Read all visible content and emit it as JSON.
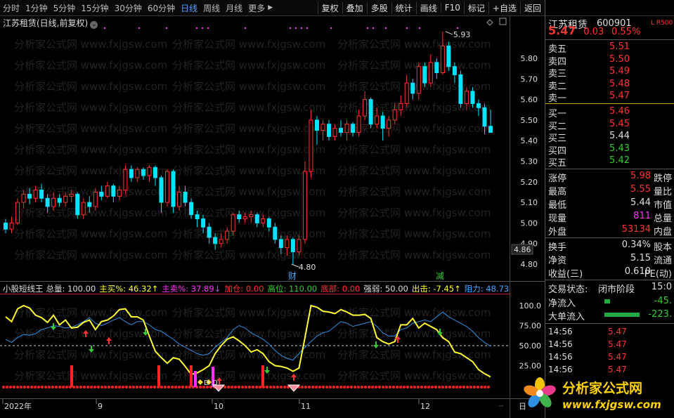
{
  "toolbar": {
    "periods": [
      "分时",
      "1分钟",
      "5分钟",
      "15分钟",
      "30分钟",
      "60分钟",
      "日线",
      "周线",
      "月线",
      "更多"
    ],
    "active_period": "日线",
    "more_arrow": "▶",
    "tools": [
      "复权",
      "叠加",
      "多股",
      "统计",
      "画线",
      "F10",
      "标记",
      "+自选",
      "返回"
    ]
  },
  "chart": {
    "title": "江苏租赁(日线,前复权)",
    "y_labels": [
      "5.80",
      "5.70",
      "5.60",
      "5.50",
      "5.40",
      "5.30",
      "5.20",
      "5.10",
      "5.00",
      "4.90",
      "4.80"
    ],
    "current_price_label": "4.86",
    "high_mark": "5.93",
    "low_mark": "4.80",
    "event_cai": "财",
    "event_jian": "减",
    "watermark": "分析家公式网 www.fxjgsw.com"
  },
  "indicator": {
    "name": "小股短线王",
    "items": [
      {
        "label": "总量: 100.00",
        "color": "#dddddd"
      },
      {
        "label": "主买%: 46.32↑",
        "color": "#ffff33"
      },
      {
        "label": "主卖%: 37.89↓",
        "color": "#ff33ff"
      },
      {
        "label": "加仓: 0.00",
        "color": "#ff3333"
      },
      {
        "label": "高位: 110.00",
        "color": "#33cc33"
      },
      {
        "label": "底部: 0.00",
        "color": "#ff3333"
      },
      {
        "label": "强弱: 50.00",
        "color": "#dddddd"
      },
      {
        "label": "出击: -7.45↑",
        "color": "#ffff33"
      },
      {
        "label": "阻力: 48.73",
        "color": "#4aa3ff"
      }
    ],
    "y_labels": [
      "100.0",
      "75.00",
      "50.00",
      "25.00"
    ],
    "marker_d": "D"
  },
  "x_axis": {
    "labels": [
      "2022年",
      "9",
      "10",
      "11",
      "12"
    ],
    "right_label": "日"
  },
  "quote": {
    "name": "江苏租赁",
    "code": "600901",
    "lr": "L R500",
    "price": "5.47",
    "change": "0.03",
    "pct": "0.55%"
  },
  "orderbook": {
    "asks": [
      {
        "label": "卖五",
        "price": "5.51"
      },
      {
        "label": "卖四",
        "price": "5.50"
      },
      {
        "label": "卖三",
        "price": "5.49"
      },
      {
        "label": "卖二",
        "price": "5.48"
      },
      {
        "label": "卖一",
        "price": "5.47"
      }
    ],
    "bids": [
      {
        "label": "买一",
        "price": "5.46",
        "cls": "red"
      },
      {
        "label": "买二",
        "price": "5.45",
        "cls": "red"
      },
      {
        "label": "买三",
        "price": "5.44",
        "cls": "white"
      },
      {
        "label": "买四",
        "price": "5.43",
        "cls": "green"
      },
      {
        "label": "买五",
        "price": "5.42",
        "cls": "green"
      }
    ]
  },
  "stats": [
    {
      "k": "涨停",
      "v": "5.98",
      "cls": "red",
      "k2": "跌停"
    },
    {
      "k": "最高",
      "v": "5.55",
      "cls": "red",
      "k2": "量比"
    },
    {
      "k": "最低",
      "v": "5.44",
      "cls": "white",
      "k2": "市值"
    },
    {
      "k": "现量",
      "v": "811",
      "cls": "mag",
      "k2": "总量"
    },
    {
      "k": "外盘",
      "v": "53134",
      "cls": "red",
      "k2": "内盘"
    }
  ],
  "stats2": [
    {
      "k": "换手",
      "v": "0.34%",
      "cls": "white",
      "k2": "股本"
    },
    {
      "k": "净资",
      "v": "5.15",
      "cls": "white",
      "k2": "流通"
    },
    {
      "k": "收益(三)",
      "v": "0.610",
      "cls": "white",
      "k2": "PE(动)"
    }
  ],
  "trade_state": {
    "label": "交易状态:",
    "value": "闭市阶段",
    "time": "15:0"
  },
  "flows": [
    {
      "label": "净流入",
      "value": "-45."
    },
    {
      "label": "大单流入",
      "value": "-223."
    }
  ],
  "ticks": [
    {
      "time": "14:56",
      "price": "5.47"
    },
    {
      "time": "14:56",
      "price": "5.47"
    },
    {
      "time": "14:56",
      "price": "5.47"
    },
    {
      "time": "14:56",
      "price": "5.47"
    }
  ],
  "logo": {
    "cn": "分析家公式网",
    "url": "www.fxjgsw.com"
  }
}
